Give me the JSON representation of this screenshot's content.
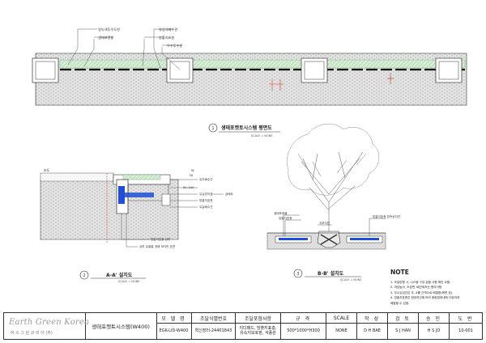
{
  "plan": {
    "labels": [
      "쌍녹색투수도판",
      "생태포켓용",
      "유입식배수관",
      "방출지표층",
      "우수투수관"
    ],
    "title_no": "1",
    "title": "생태포켓토시스템 평면도",
    "scale": "SCALE = NONE"
  },
  "section_a": {
    "left_label": "보도",
    "side_labels": [
      "유지배수관",
      "W=240",
      "유실방지관",
      "방출지표층",
      "유실배수관",
      "급배트"
    ],
    "top_labels": [
      "W",
      "FA"
    ],
    "bottom_labels": [
      "방출지표층 상치",
      "상부 유출통 개패 보다반 표면"
    ],
    "title_no": "2",
    "title": "A-A' 설치도",
    "scale": "SCALE = NONE"
  },
  "section_b": {
    "left_labels": [
      "생태포켓볼",
      "방출지표층"
    ],
    "mid_label": "석포지반",
    "right_label": "방출지표층 접속상치관",
    "title_no": "3",
    "title": "B-B' 설치도",
    "scale": "SCALE = NONE"
  },
  "note": {
    "heading": "NOTE",
    "items": [
      "1. 조일방향 시, 시스템 구성 분할 사항 확인 요함.",
      "2. 마감높이, 조경면, 배관위치는 협의사항.",
      "3. 우수유입관은 초 -4를 간격으로 배열함(육면 참).",
      "4. 방출지표층은 현장여건에 따라 종량범위내에 다양하게",
      "   배열할 수 있음."
    ]
  },
  "title_block": {
    "logo_main": "Earth Green Korea",
    "logo_sub": "어 스 그 린 코 리 아 (주)",
    "drawing_name": "생태포켓토시스템(W400)",
    "columns": [
      {
        "head": "모 델 명",
        "value": "EGK-LID-W400"
      },
      {
        "head": "조달식별번호",
        "value": "혁신장터-24401843"
      },
      {
        "head": "조달포함사항",
        "value": "지디패드, 방출지표층,\n유속지보호판, 석종관"
      },
      {
        "head": "규 격",
        "value": "500*1000*H300"
      },
      {
        "head": "SCALE",
        "value": "NONE"
      },
      {
        "head": "작 성",
        "value": "D H BAE"
      },
      {
        "head": "검 토",
        "value": "S J HAN"
      },
      {
        "head": "승 인",
        "value": "H S JO"
      },
      {
        "head": "도 번",
        "value": "10-001"
      }
    ]
  },
  "colors": {
    "line": "#333333",
    "green_band": "#cfe6cf",
    "blue": "#1f4fd8",
    "red_dim": "#d02020",
    "ground": "#bdbdbd"
  }
}
